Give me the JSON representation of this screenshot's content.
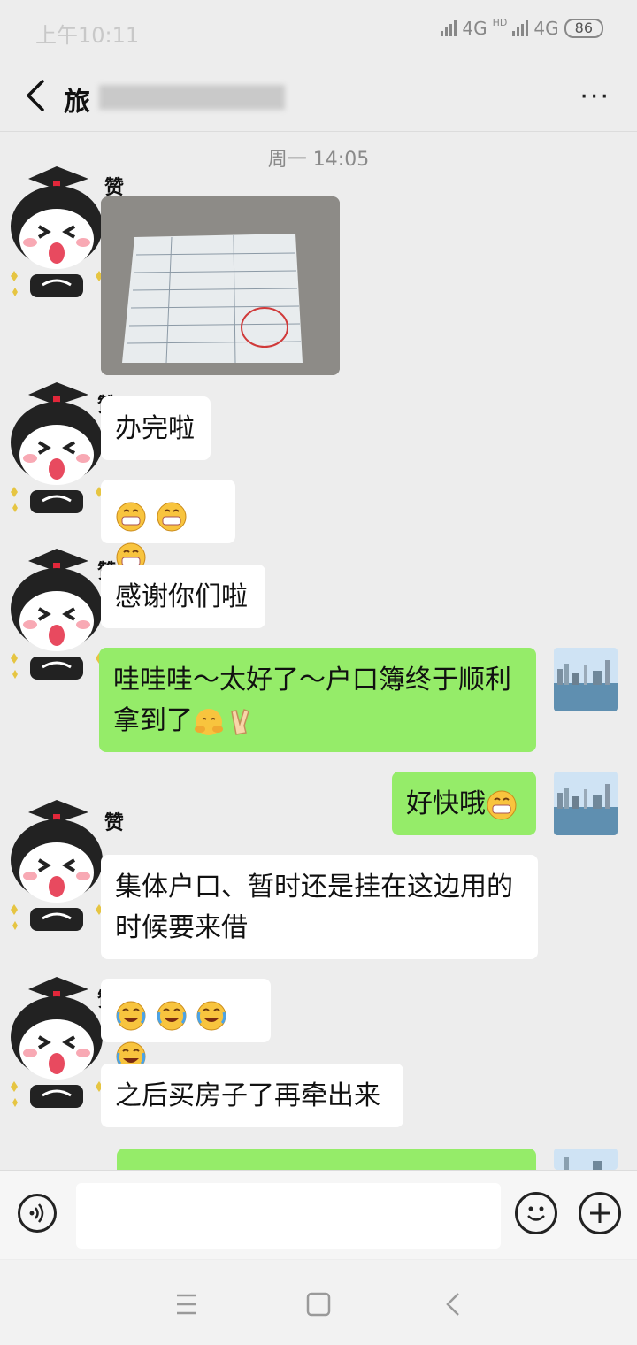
{
  "status": {
    "time": "上午10:11",
    "network1": "4G",
    "network2": "4G",
    "hd": "HD",
    "battery": "86"
  },
  "header": {
    "title": "旅",
    "more": "···"
  },
  "timestamp": "周一 14:05",
  "messages": [
    {
      "type": "image",
      "sender": "other",
      "description": "registration-card-photo"
    },
    {
      "type": "text",
      "sender": "other",
      "text": "办完啦"
    },
    {
      "type": "emoji",
      "sender": "other",
      "emojis": [
        "grin-icon",
        "grin-icon",
        "grin-icon"
      ]
    },
    {
      "type": "text",
      "sender": "other",
      "text": "感谢你们啦"
    },
    {
      "type": "text",
      "sender": "me",
      "line1": "哇哇哇～太好了～户口簿终于顺利",
      "line2": "拿到了"
    },
    {
      "type": "text",
      "sender": "me",
      "text": "好快哦"
    },
    {
      "type": "text",
      "sender": "other",
      "line1": "集体户口、暂时还是挂在这边用的",
      "line2": "时候要来借"
    },
    {
      "type": "emoji",
      "sender": "other",
      "emojis": [
        "laugh-cry-icon",
        "laugh-cry-icon",
        "laugh-cry-icon",
        "laugh-cry-icon"
      ]
    },
    {
      "type": "text",
      "sender": "other",
      "text": "之后买房子了再牵出来"
    }
  ],
  "sticker": {
    "label": "赞"
  },
  "colors": {
    "my_bubble": "#95ec69",
    "their_bubble": "#ffffff",
    "background": "#ededed"
  }
}
